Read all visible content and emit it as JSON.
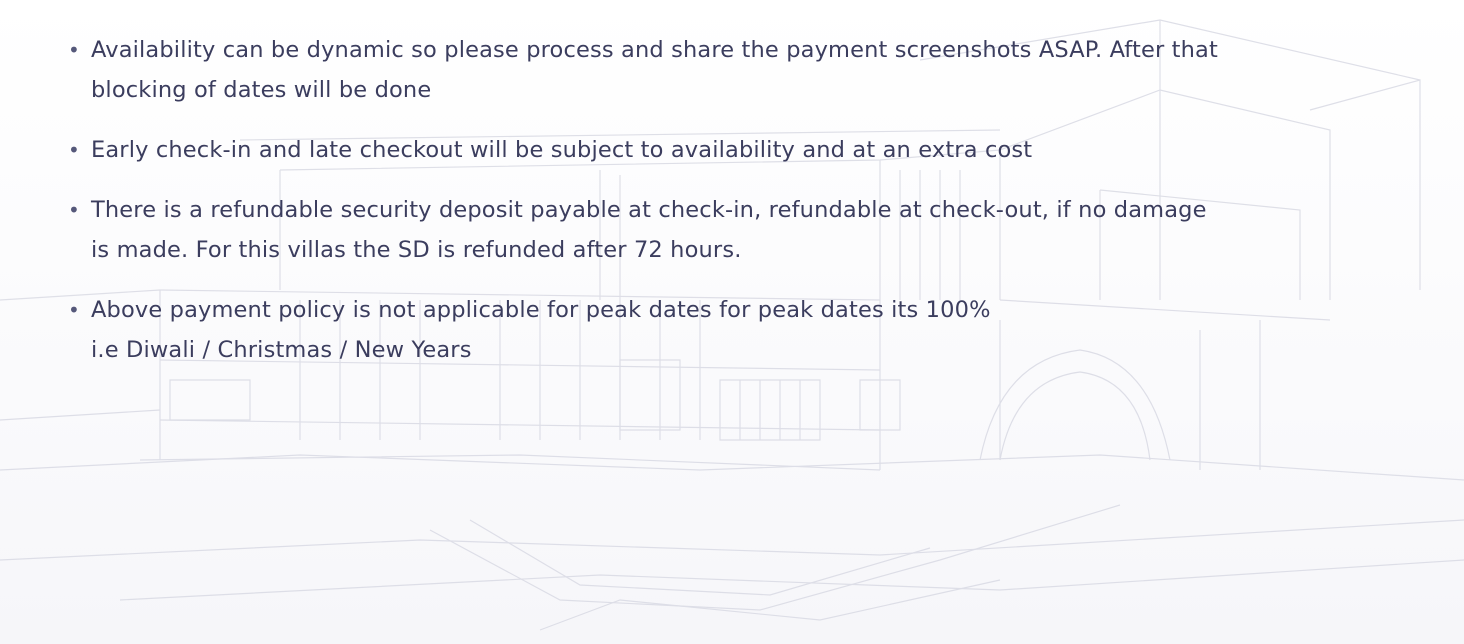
{
  "policy": {
    "items": [
      {
        "lines": [
          "Availability can be dynamic so please process and share the payment screenshots ASAP. After that",
          "blocking of dates will be done"
        ]
      },
      {
        "lines": [
          "Early check-in and late checkout will be subject to availability and at an extra cost"
        ]
      },
      {
        "lines": [
          "There is a refundable security deposit payable at check-in, refundable at check-out, if no damage",
          "is made. For this villas the SD is refunded after 72 hours."
        ]
      },
      {
        "lines": [
          "Above payment policy is not applicable for peak dates for peak dates its 100%",
          "i.e Diwali / Christmas / New Years"
        ]
      }
    ]
  }
}
